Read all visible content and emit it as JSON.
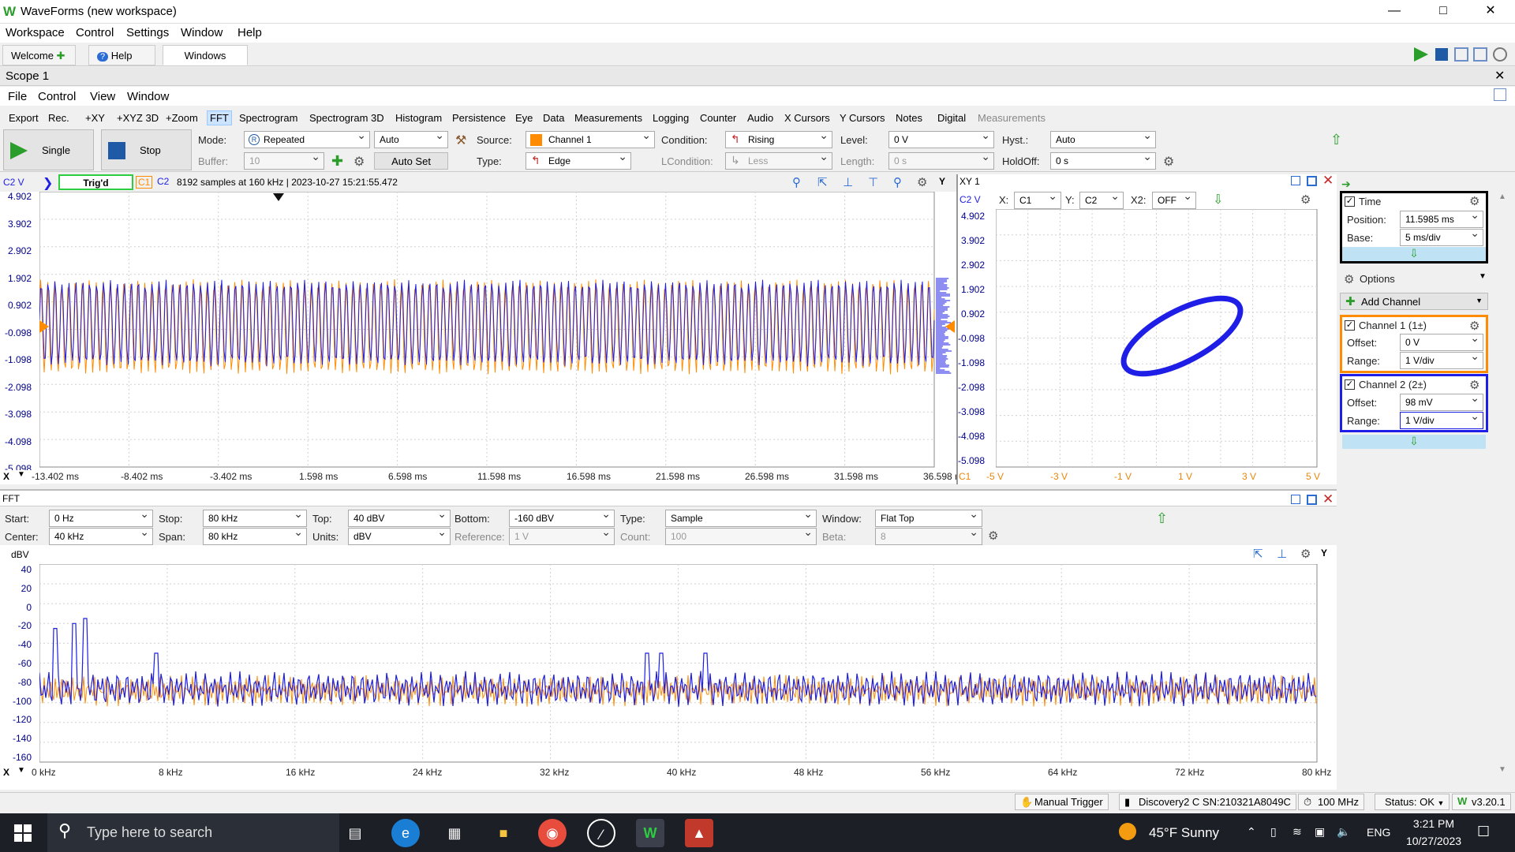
{
  "app": {
    "title": "WaveForms (new workspace)",
    "menus": [
      "Workspace",
      "Control",
      "Settings",
      "Window",
      "Help"
    ]
  },
  "tabs": [
    "Welcome",
    "Help",
    "Windows"
  ],
  "scope": {
    "title": "Scope 1",
    "menus": [
      "File",
      "Control",
      "View",
      "Window"
    ],
    "toolbar": [
      "Export",
      "Rec.",
      "+XY",
      "+XYZ 3D",
      "+Zoom",
      "FFT",
      "Spectrogram",
      "Spectrogram 3D",
      "Histogram",
      "Persistence",
      "Eye",
      "Data",
      "Measurements",
      "Logging",
      "Counter",
      "Audio",
      "X Cursors",
      "Y Cursors",
      "Notes",
      "Digital",
      "Measurements"
    ],
    "single": "Single",
    "stop": "Stop",
    "mode_label": "Mode:",
    "mode": "Repeated",
    "mode_auto": "Auto",
    "buffer_label": "Buffer:",
    "buffer": "10",
    "autoset": "Auto Set",
    "source_label": "Source:",
    "source": "Channel 1",
    "type_label": "Type:",
    "type": "Edge",
    "condition_label": "Condition:",
    "condition": "Rising",
    "lcondition_label": "LCondition:",
    "lcondition": "Less",
    "level_label": "Level:",
    "level": "0 V",
    "length_label": "Length:",
    "length": "0 s",
    "hyst_label": "Hyst.:",
    "hyst": "Auto",
    "holdoff_label": "HoldOff:",
    "holdoff": "0 s",
    "status_ch": "C2 V",
    "trig": "Trig'd",
    "c1": "C1",
    "c2": "C2",
    "info": "8192 samples at 160 kHz | 2023-10-27 15:21:55.472",
    "y_ticks": [
      "4.902",
      "3.902",
      "2.902",
      "1.902",
      "0.902",
      "-0.098",
      "-1.098",
      "-2.098",
      "-3.098",
      "-4.098",
      "-5.098"
    ],
    "x_ticks": [
      "-13.402 ms",
      "-8.402 ms",
      "-3.402 ms",
      "1.598 ms",
      "6.598 ms",
      "11.598 ms",
      "16.598 ms",
      "21.598 ms",
      "26.598 ms",
      "31.598 ms",
      "36.598 m"
    ],
    "x_btn": "X",
    "y_btn": "Y"
  },
  "xy": {
    "title": "XY 1",
    "ch": "C2 V",
    "x_label": "X:",
    "x": "C1",
    "y_label": "Y:",
    "y": "C2",
    "x2_label": "X2:",
    "x2": "OFF",
    "y_ticks": [
      "4.902",
      "3.902",
      "2.902",
      "1.902",
      "0.902",
      "-0.098",
      "-1.098",
      "-2.098",
      "-3.098",
      "-4.098",
      "-5.098"
    ],
    "x_ticks": [
      "-5 V",
      "-3 V",
      "-1 V",
      "1 V",
      "3 V",
      "5 V"
    ],
    "c1": "C1"
  },
  "side": {
    "time": "Time",
    "position_label": "Position:",
    "position": "11.5985 ms",
    "base_label": "Base:",
    "base": "5 ms/div",
    "options": "Options",
    "add_channel": "Add Channel",
    "ch1": "Channel 1 (1±)",
    "ch1_offset": "0 V",
    "ch1_range": "1 V/div",
    "ch2": "Channel 2 (2±)",
    "ch2_offset": "98 mV",
    "ch2_range": "1 V/div",
    "offset_label": "Offset:",
    "range_label": "Range:"
  },
  "fft": {
    "title": "FFT",
    "start_label": "Start:",
    "start": "0 Hz",
    "stop_label": "Stop:",
    "stop": "80 kHz",
    "top_label": "Top:",
    "top": "40 dBV",
    "bottom_label": "Bottom:",
    "bottom": "-160 dBV",
    "type_label": "Type:",
    "type": "Sample",
    "window_label": "Window:",
    "window": "Flat Top",
    "center_label": "Center:",
    "center": "40 kHz",
    "span_label": "Span:",
    "span": "80 kHz",
    "units_label": "Units:",
    "units": "dBV",
    "reference_label": "Reference:",
    "reference": "1 V",
    "count_label": "Count:",
    "count": "100",
    "beta_label": "Beta:",
    "beta": "8",
    "unit": "dBV",
    "y_ticks": [
      "40",
      "20",
      "0",
      "-20",
      "-40",
      "-60",
      "-80",
      "-100",
      "-120",
      "-140",
      "-160"
    ],
    "x_ticks": [
      "0 kHz",
      "8 kHz",
      "16 kHz",
      "24 kHz",
      "32 kHz",
      "40 kHz",
      "48 kHz",
      "56 kHz",
      "64 kHz",
      "72 kHz",
      "80 kHz"
    ]
  },
  "status": {
    "trigger": "Manual Trigger",
    "device": "Discovery2 C SN:210321A8049C",
    "freq": "100 MHz",
    "status": "Status: OK",
    "version": "v3.20.1"
  },
  "taskbar": {
    "search": "Type here to search",
    "weather": "45°F  Sunny",
    "lang": "ENG",
    "time": "3:21 PM",
    "date": "10/27/2023"
  },
  "colors": {
    "ch1": "#ff8c00",
    "ch2": "#1e1ee6",
    "accent": "#2a9d2a"
  }
}
